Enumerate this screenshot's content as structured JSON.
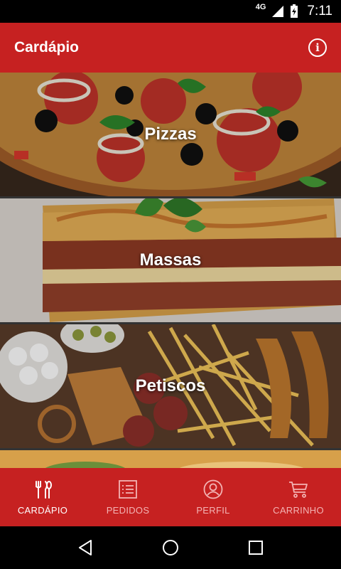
{
  "status_bar": {
    "network": "4G",
    "time": "7:11"
  },
  "app_bar": {
    "title": "Cardápio",
    "info_icon": "info-icon"
  },
  "categories": [
    {
      "label": "Pizzas"
    },
    {
      "label": "Massas"
    },
    {
      "label": "Petiscos"
    }
  ],
  "bottom_nav": {
    "items": [
      {
        "label": "CARDÁPIO",
        "icon": "cutlery-icon",
        "active": true
      },
      {
        "label": "PEDIDOS",
        "icon": "list-icon",
        "active": false
      },
      {
        "label": "PERFIL",
        "icon": "user-icon",
        "active": false
      },
      {
        "label": "CARRINHO",
        "icon": "cart-icon",
        "active": false
      }
    ]
  },
  "colors": {
    "primary": "#c62121",
    "nav_inactive": "#f3b3b3"
  }
}
